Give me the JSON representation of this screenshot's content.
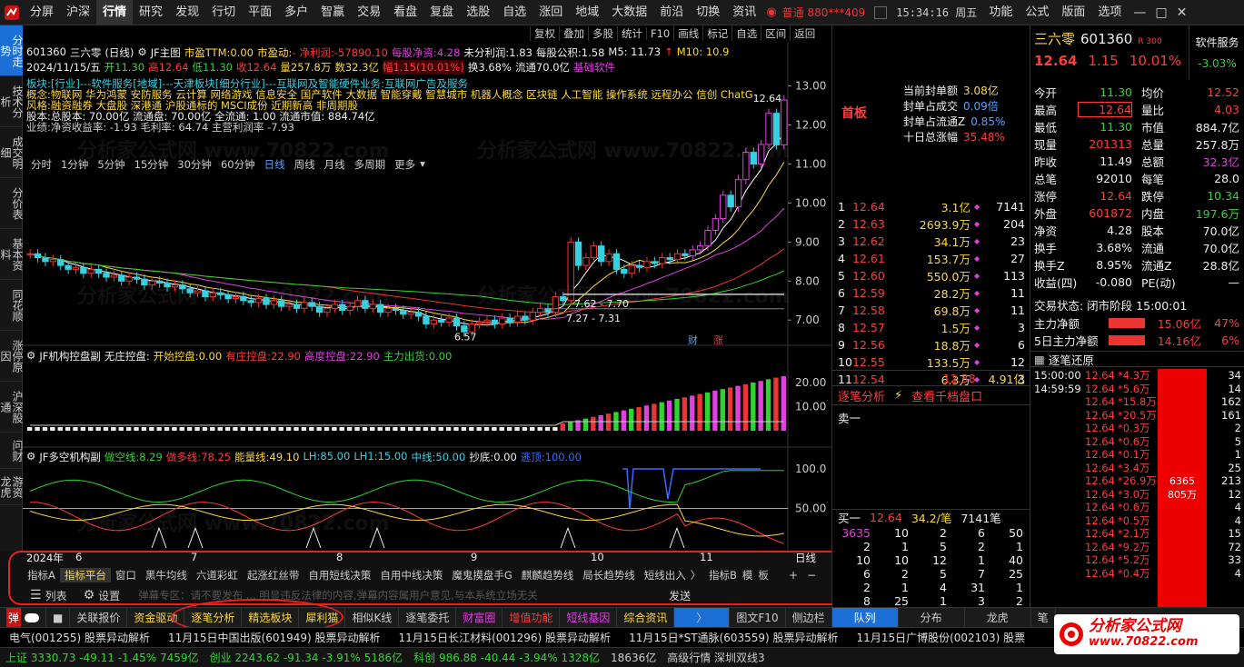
{
  "menu": {
    "items": [
      "分屏",
      "沪深",
      "行情",
      "研究",
      "发现",
      "行切",
      "平面",
      "多户",
      "智赢",
      "交易",
      "看盘",
      "复盘",
      "选股",
      "自选",
      "涨回",
      "地域",
      "大数据",
      "前沿",
      "切换",
      "资讯"
    ],
    "active_index": 2,
    "account": "普通 880***409",
    "clock": "15:34:16 周五",
    "right_items": [
      "功能",
      "公式",
      "版面",
      "选项"
    ]
  },
  "left_tabs": [
    "分时走势",
    "技术分析",
    "成交明细",
    "分价表",
    "基本资料",
    "同花顺",
    "涨停原因",
    "沪深股通",
    "问财",
    "游资龙虎"
  ],
  "stock": {
    "code": "601360",
    "name": "三六零",
    "period_label": "日线",
    "ind_name": "JF主图",
    "pe_ttm_label": "市盈TTM:",
    "pe_ttm": "0.00",
    "pe_dyn_label": "市盈动:",
    "pe_dyn": "-",
    "profit_label": "净利润:",
    "profit": "-57890.10",
    "eps_label": "每股净资:",
    "eps": "4.28",
    "undist_label": "未分利润:",
    "undist": "1.83",
    "fund_label": "每股公积:",
    "fund": "1.58",
    "m5": "M5: 11.73",
    "m10": "M10: 10.9",
    "date": "2024/11/15/五",
    "open": "开11.30",
    "high": "高12.64",
    "low": "低11.30",
    "close": "收12.64",
    "amount": "量257.8万",
    "value": "数32.3亿",
    "change": "幅1.15(10.01%)",
    "turnover": "换3.68%",
    "float": "流通70.0亿",
    "sector": "基础软件"
  },
  "chart_toolbar": [
    "复权",
    "叠加",
    "多股",
    "统计",
    "F10",
    "画线",
    "标记",
    "自选",
    "区间",
    "返回"
  ],
  "periods": [
    "分时",
    "1分钟",
    "5分钟",
    "15分钟",
    "30分钟",
    "60分钟",
    "日线",
    "周线",
    "月线",
    "多周期",
    "更多"
  ],
  "info_lines": [
    {
      "label": "板块:",
      "text": "[行业]---软件服务[地域]---天津板块[细分行业]---互联网及智能硬件业务:互联网广告及服务"
    },
    {
      "label": "概念:",
      "text": "物联网 华为鸿蒙 安防服务 云计算 网络游戏 信息安全 国产软件 大数据 智能穿戴 智慧城市 机器人概念 区块链 人工智能 操作系统 远程办公 信创 ChatG"
    },
    {
      "label": "风格:",
      "text": "融资融券 大盘股 深港通 沪股通标的 MSCI成份 近期新高 非周期股"
    },
    {
      "label": "股本:",
      "text": "总股本: 70.00亿 流通盘: 70.00亿 全流通: 1.00 流通市值: 884.74亿"
    },
    {
      "label": "业绩:",
      "text": "净资收益率: -1.93 毛利率: 64.74 主营利润率 -7.93"
    }
  ],
  "price_axis": [
    "13.00",
    "12.00",
    "11.00",
    "10.00",
    "9.00",
    "8.00",
    "7.00"
  ],
  "chart_annotations": {
    "high": "12.64",
    "a": "7.62 - 7.70",
    "b": "7.27 - 7.31",
    "low": "6.57",
    "badges": [
      "财",
      "涨"
    ]
  },
  "chart_data": [
    {
      "type": "candlestick",
      "title": "JF主图",
      "x_label": "",
      "ylim": [
        6.4,
        13.2
      ],
      "closes": [
        8.7,
        8.6,
        8.5,
        8.55,
        8.4,
        8.3,
        8.35,
        8.2,
        8.3,
        8.2,
        8.1,
        8.15,
        8.0,
        8.1,
        8.05,
        7.9,
        8.0,
        7.95,
        7.85,
        7.9,
        7.8,
        7.7,
        7.75,
        7.6,
        7.7,
        7.65,
        7.55,
        7.6,
        7.5,
        7.45,
        7.55,
        7.4,
        7.5,
        7.35,
        7.4,
        7.3,
        7.45,
        7.35,
        7.2,
        7.3,
        7.4,
        7.25,
        7.35,
        7.5,
        7.3,
        7.4,
        7.2,
        7.3,
        7.25,
        7.15,
        7.2,
        7.1,
        6.9,
        7.0,
        6.95,
        7.05,
        6.85,
        6.7,
        6.9,
        6.95,
        7.0,
        6.9,
        7.05,
        6.95,
        7.1,
        7.0,
        7.2,
        7.3,
        7.2,
        7.6,
        7.5,
        9.0,
        8.4,
        8.6,
        8.9,
        8.5,
        8.7,
        8.3,
        8.2,
        8.4,
        8.35,
        8.5,
        8.45,
        8.6,
        8.55,
        8.7,
        8.65,
        8.8,
        8.9,
        9.3,
        9.6,
        10.2,
        9.9,
        10.6,
        11.3,
        11.0,
        11.5,
        12.3,
        11.49,
        12.64
      ],
      "series": []
    },
    {
      "type": "bar",
      "title": "JF机构控盘副",
      "x_label": "",
      "ylim": [
        0,
        25
      ],
      "values_summary": {
        "无庄控盘": "0.00",
        "开始控盘": "0.00",
        "有庄控盘": "22.90",
        "高度控盘": "22.90",
        "主力出货": "0.00"
      },
      "ticks": [
        "20.00",
        "10.00"
      ]
    },
    {
      "type": "line",
      "title": "JF多空机构副",
      "x_label": "",
      "ylim": [
        0,
        100
      ],
      "ticks": [
        "100.0",
        "50.00",
        "0.00"
      ],
      "series": [
        {
          "name": "做空线",
          "last": "8.29"
        },
        {
          "name": "做多线",
          "last": "78.25"
        },
        {
          "name": "能量线",
          "last": "49.10"
        },
        {
          "name": "LH",
          "last": "85.00"
        },
        {
          "name": "LH1",
          "last": "15.00"
        },
        {
          "name": "中线",
          "last": "50.00"
        },
        {
          "name": "抄底",
          "last": "0.00"
        },
        {
          "name": "逃顶",
          "last": "100.00"
        }
      ]
    }
  ],
  "sub1": {
    "title": "JF机构控盘副",
    "labels": [
      {
        "k": "无庄控盘:",
        "v": ""
      },
      {
        "k": "开始控盘:",
        "v": "0.00"
      },
      {
        "k": "有庄控盘:",
        "v": "22.90"
      },
      {
        "k": "高度控盘:",
        "v": "22.90"
      },
      {
        "k": "主力出货:",
        "v": "0.00"
      }
    ],
    "ticks": [
      "20.00",
      "10.00"
    ]
  },
  "sub2": {
    "title": "JF多空机构副",
    "labels": [
      {
        "k": "做空线:",
        "v": "8.29"
      },
      {
        "k": "做多线:",
        "v": "78.25"
      },
      {
        "k": "能量线:",
        "v": "49.10"
      },
      {
        "k": "LH:",
        "v": "85.00"
      },
      {
        "k": "LH1:",
        "v": "15.00"
      },
      {
        "k": "中线:",
        "v": "50.00"
      },
      {
        "k": "抄底:",
        "v": "0.00"
      },
      {
        "k": "逃顶:",
        "v": "100.00"
      }
    ],
    "ticks": [
      "100.0",
      "50.00"
    ]
  },
  "date_axis": {
    "year": "2024年",
    "months": [
      "6",
      "7",
      "8",
      "9",
      "10",
      "11"
    ],
    "period": "日线"
  },
  "bottom_tabs": [
    "指标A",
    "指标平台",
    "窗口",
    "黑牛均线",
    "六道彩虹",
    "起涨红丝带",
    "自用短线决策",
    "自用中线决策",
    "魔鬼摸盘手G",
    "麒麟趋势线",
    "局长趋势线",
    "短线出入"
  ],
  "bottom_tabs2": [
    "指标B",
    "模",
    "板"
  ],
  "bottom_row2": {
    "list": "列表",
    "settings": "设置",
    "marquee": "弹幕专区：请不要发布 ... 明显违反法律的内容,弹幕内容属用户意见,与本系统立场无关",
    "send": "发送"
  },
  "quickbar": [
    "关联报价",
    "资金驱动",
    "逐笔分析",
    "精选板块",
    "犀利猫",
    "相似K线",
    "逐笔委托",
    "财富圈",
    "增值功能",
    "短线基因",
    "综合资讯",
    "图文F10",
    "侧边栏",
    "队列",
    "分布",
    "龙虎",
    "笔"
  ],
  "news": [
    "电气(001255) 股票异动解析",
    "11月15日中国出版(601949) 股票异动解析",
    "11月15日长江材料(001296) 股票异动解析",
    "11月15日*ST通脉(603559) 股票异动解析",
    "11月15日广博股份(002103) 股票"
  ],
  "statusbar": [
    "上证 3330.73 -49.11 -1.45% 7459亿",
    "创业 2243.62 -91.34 -3.91% 5186亿",
    "科创 986.88 -40.44 -3.94% 1328亿",
    "18636亿",
    "高级行情 深圳双线3"
  ],
  "quote": {
    "name": "三六零",
    "code": "601360",
    "tag": "R 300",
    "sector": "软件服务",
    "sector_pct": "-3.03%",
    "price": "12.64",
    "chg": "1.15",
    "pct": "10.01%",
    "limit_tag": "首板",
    "seal": [
      {
        "k": "当前封单额",
        "v": "3.08亿"
      },
      {
        "k": "封单占成交",
        "v": "0.09倍"
      },
      {
        "k": "封单占流通Z",
        "v": "0.85%"
      },
      {
        "k": "十日总涨幅",
        "v": "35.48%"
      }
    ]
  },
  "book": [
    {
      "n": "1",
      "p": "12.64",
      "v": "3.1亿",
      "c": "7141"
    },
    {
      "n": "2",
      "p": "12.63",
      "v": "2693.9万",
      "c": "204"
    },
    {
      "n": "3",
      "p": "12.62",
      "v": "34.1万",
      "c": "23"
    },
    {
      "n": "4",
      "p": "12.61",
      "v": "153.7万",
      "c": "27"
    },
    {
      "n": "5",
      "p": "12.60",
      "v": "550.0万",
      "c": "113"
    },
    {
      "n": "6",
      "p": "12.59",
      "v": "28.2万",
      "c": "11"
    },
    {
      "n": "7",
      "p": "12.58",
      "v": "69.8万",
      "c": "11"
    },
    {
      "n": "8",
      "p": "12.57",
      "v": "1.5万",
      "c": "3"
    },
    {
      "n": "9",
      "p": "12.56",
      "v": "18.8万",
      "c": "6"
    },
    {
      "n": "10",
      "p": "12.55",
      "v": "133.5万",
      "c": "12"
    },
    {
      "n": "11",
      "p": "12.54",
      "v": "6.3万",
      "c": "3"
    }
  ],
  "book_footer": {
    "p": "12.38",
    "v": "4.91亿"
  },
  "tick_panel": {
    "tab1": "逐笔分析",
    "tab2": "查看千档盘口",
    "sell1": "卖一",
    "buy1": "买一",
    "buy1_p": "12.64",
    "buy1_v": "34.2/笔",
    "buy1_c": "7141笔",
    "grid": [
      [
        "3635",
        "10",
        "2",
        "6",
        "50"
      ],
      [
        "2",
        "1",
        "5",
        "2",
        "1"
      ],
      [
        "10",
        "10",
        "12",
        "1",
        "40"
      ],
      [
        "6",
        "2",
        "5",
        "7",
        "25"
      ],
      [
        "2",
        "1",
        "4",
        "31",
        "1"
      ],
      [
        "8",
        "25",
        "1",
        "3",
        "2"
      ]
    ]
  },
  "stats": [
    {
      "k1": "今开",
      "v1": "11.30",
      "k2": "均价",
      "v2": "12.52"
    },
    {
      "k1": "最高",
      "v1": "12.64",
      "k2": "量比",
      "v2": "4.03"
    },
    {
      "k1": "最低",
      "v1": "11.30",
      "k2": "市值",
      "v2": "884.7亿"
    },
    {
      "k1": "现量",
      "v1": "201313",
      "k2": "总量",
      "v2": "257.8万"
    },
    {
      "k1": "昨收",
      "v1": "11.49",
      "k2": "总额",
      "v2": "32.3亿"
    },
    {
      "k1": "总笔",
      "v1": "92010",
      "k2": "每笔",
      "v2": "28.0"
    },
    {
      "k1": "涨停",
      "v1": "12.64",
      "k2": "跌停",
      "v2": "10.34"
    },
    {
      "k1": "外盘",
      "v1": "601872",
      "k2": "内盘",
      "v2": "197.6万"
    },
    {
      "k1": "净资",
      "v1": "4.28",
      "k2": "股本",
      "v2": "70.0亿"
    },
    {
      "k1": "换手",
      "v1": "3.68%",
      "k2": "流通",
      "v2": "70.0亿"
    },
    {
      "k1": "换手Z",
      "v1": "8.95%",
      "k2": "流通Z",
      "v2": "28.8亿"
    },
    {
      "k1": "收益(四)",
      "v1": "-0.080",
      "k2": "PE(动)",
      "v2": "—"
    }
  ],
  "trade_status": "交易状态: 闭市阶段 15:00:01",
  "flows": [
    {
      "k": "主力净额",
      "v": "15.06亿",
      "p": "47%"
    },
    {
      "k": "5日主力净额",
      "v": "14.16亿",
      "p": "6%"
    }
  ],
  "trades_title": "逐笔还原",
  "trades": [
    {
      "t": "15:00:00",
      "p": "12.64",
      "v": "4.3万",
      "c": "34"
    },
    {
      "t": "14:59:59",
      "p": "12.64",
      "v": "5.6万",
      "c": "14"
    },
    {
      "t": "",
      "p": "12.64",
      "v": "15.8万",
      "c": "162"
    },
    {
      "t": "",
      "p": "12.64",
      "v": "20.5万",
      "c": "161"
    },
    {
      "t": "",
      "p": "12.64",
      "v": "0.3万",
      "c": "2"
    },
    {
      "t": "",
      "p": "12.64",
      "v": "0.6万",
      "c": "5"
    },
    {
      "t": "",
      "p": "12.64",
      "v": "0.1万",
      "c": "1"
    },
    {
      "t": "",
      "p": "12.64",
      "v": "3.4万",
      "c": "25"
    },
    {
      "t": "",
      "p": "12.64",
      "v": "26.9万",
      "c": "213"
    },
    {
      "t": "",
      "p": "12.64",
      "v": "3.0万",
      "c": "12"
    },
    {
      "t": "",
      "p": "12.64",
      "v": "0.6万",
      "c": "4"
    },
    {
      "t": "",
      "p": "12.64",
      "v": "0.5万",
      "c": "4"
    },
    {
      "t": "",
      "p": "12.64",
      "v": "2.1万",
      "c": "15"
    },
    {
      "t": "",
      "p": "12.64",
      "v": "9.2万",
      "c": "72"
    },
    {
      "t": "",
      "p": "12.64",
      "v": "5.2万",
      "c": "33"
    },
    {
      "t": "",
      "p": "12.64",
      "v": "0.4万",
      "c": "4"
    }
  ],
  "trades_bar": {
    "a": "6365",
    "b": "805万"
  },
  "watermark": "分析家公式网 www.70822.com",
  "logo": {
    "title": "分析家公式网",
    "url": "www.70822.com"
  }
}
